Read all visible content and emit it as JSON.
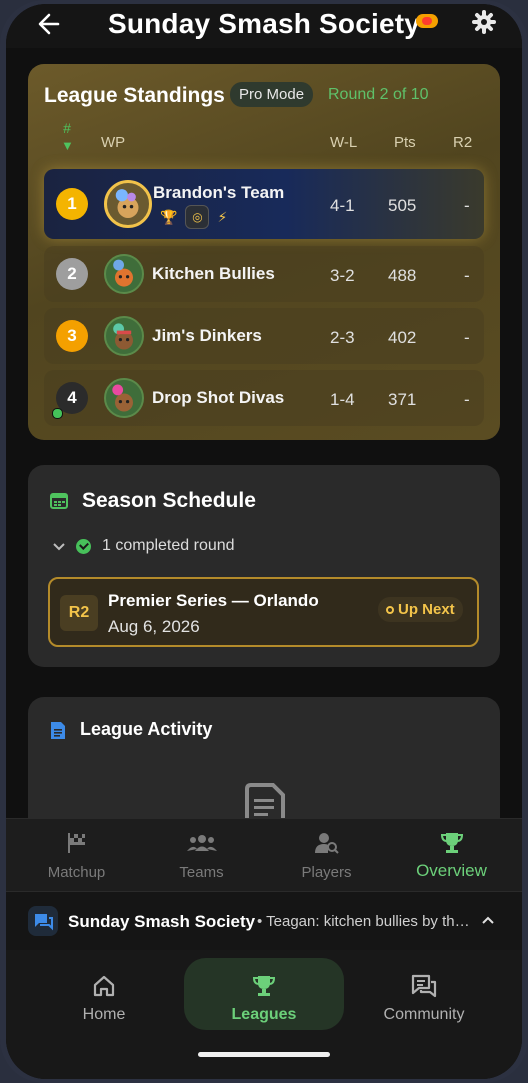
{
  "header": {
    "title": "Sunday Smash Society"
  },
  "standings": {
    "title": "League Standings",
    "mode_pill": "Pro Mode",
    "round_status": "Round 2 of 10",
    "columns": {
      "rank": "#",
      "wp": "WP",
      "wl": "W-L",
      "pts": "Pts",
      "r2": "R2"
    },
    "rows": [
      {
        "rank": "1",
        "team": "Brandon's Team",
        "wl": "4-1",
        "pts": "505",
        "r2": "-",
        "rank_color": "#f4b400"
      },
      {
        "rank": "2",
        "team": "Kitchen Bullies",
        "wl": "3-2",
        "pts": "488",
        "r2": "-",
        "rank_color": "#9e9e9e"
      },
      {
        "rank": "3",
        "team": "Jim's Dinkers",
        "wl": "2-3",
        "pts": "402",
        "r2": "-",
        "rank_color": "#f4a000"
      },
      {
        "rank": "4",
        "team": "Drop Shot Divas",
        "wl": "1-4",
        "pts": "371",
        "r2": "-",
        "rank_color": "#2b2b2b"
      }
    ]
  },
  "schedule": {
    "title": "Season Schedule",
    "completed": "1 completed round",
    "next": {
      "tag": "R2",
      "name": "Premier Series — Orlando",
      "date": "Aug 6, 2026",
      "status": "Up Next"
    }
  },
  "activity": {
    "title": "League Activity"
  },
  "league_tabs": [
    {
      "label": "Matchup",
      "icon": "flag-icon"
    },
    {
      "label": "Teams",
      "icon": "people-icon"
    },
    {
      "label": "Players",
      "icon": "person-search-icon"
    },
    {
      "label": "Overview",
      "icon": "trophy-icon",
      "active": true
    }
  ],
  "chat": {
    "name": "Sunday Smash Society",
    "message": "• Teagan: kitchen bullies by the way"
  },
  "main_nav": [
    {
      "label": "Home",
      "icon": "home-icon"
    },
    {
      "label": "Leagues",
      "icon": "trophy-icon",
      "active": true
    },
    {
      "label": "Community",
      "icon": "chat-icon"
    }
  ],
  "colors": {
    "accent_green": "#6cd07a",
    "gold": "#f3c44a",
    "background": "#101010"
  }
}
